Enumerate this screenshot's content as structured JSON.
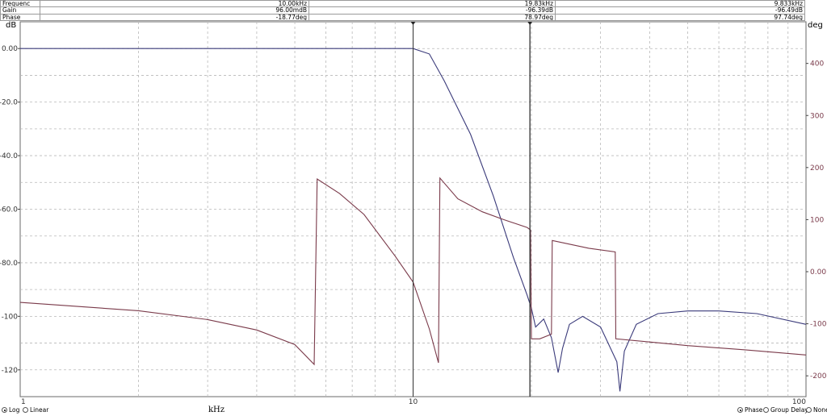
{
  "readout": {
    "rows": [
      {
        "label": "Frequenc",
        "c1": "10.00kHz",
        "c2": "19.83kHz",
        "c3": "9.833kHz"
      },
      {
        "label": "Gain",
        "c1": "96.00mdB",
        "c2": "-96.39dB",
        "c3": "-96.49dB"
      },
      {
        "label": "Phase",
        "c1": "-18.77deg",
        "c2": "78.97deg",
        "c3": "97.74deg"
      }
    ]
  },
  "axes": {
    "left_unit": "dB",
    "right_unit": "deg",
    "xlabel": "kHz"
  },
  "controls": {
    "scale_options": [
      {
        "label": "Log",
        "selected": true
      },
      {
        "label": "Linear",
        "selected": false
      }
    ],
    "view_options": [
      {
        "label": "Phase",
        "selected": true
      },
      {
        "label": "Group Delay",
        "selected": false
      },
      {
        "label": "None",
        "selected": false
      }
    ]
  },
  "chart_data": {
    "type": "line",
    "x_scale": "log",
    "xlim": [
      1,
      100
    ],
    "x_ticks": [
      "1",
      "10",
      "100"
    ],
    "ylim_left": [
      -130,
      10
    ],
    "y_left_ticks": [
      "0.00",
      "-20.0",
      "-40.0",
      "-60.0",
      "-80.0",
      "-100",
      "-120"
    ],
    "ylim_right": [
      -240,
      480
    ],
    "y_right_ticks": [
      "400",
      "300",
      "200",
      "100",
      "0.00",
      "-100",
      "-200"
    ],
    "grid": true,
    "cursors_khz": [
      10.0,
      19.83
    ],
    "series": [
      {
        "axis": "left",
        "color": "#3a3a7a",
        "x": [
          1,
          8.0,
          9.0,
          10.0,
          11.0,
          12.0,
          14.0,
          16.0,
          18.0,
          19.5,
          20.0,
          20.5,
          21.5,
          22.5,
          23.4,
          24.0,
          25.0,
          27.0,
          30.0,
          33.0,
          33.6,
          34.5,
          37.0,
          42.0,
          50.0,
          60.0,
          75.0,
          100.0
        ],
        "y": [
          0,
          0,
          0,
          0,
          -2,
          -12,
          -32,
          -55,
          -78,
          -92,
          -97,
          -104,
          -101,
          -108,
          -121,
          -112,
          -103,
          -100,
          -104,
          -117,
          -128,
          -113,
          -103,
          -99,
          -98,
          -98,
          -99,
          -103
        ]
      },
      {
        "axis": "right",
        "color": "#7a3a4a",
        "x": [
          1,
          2,
          3,
          4,
          5,
          5.6,
          5.7,
          6.5,
          7.5,
          9.0,
          10.0,
          11.0,
          11.6,
          11.7,
          13.0,
          15.0,
          17.0,
          19.5,
          19.9,
          20.0,
          21.0,
          22.5,
          22.6,
          28.0,
          32.7,
          32.8,
          40.0,
          50.0,
          70.0,
          100.0
        ],
        "y": [
          -59,
          -75,
          -92,
          -112,
          -140,
          -178,
          178,
          150,
          110,
          30,
          -20,
          -110,
          -175,
          180,
          140,
          115,
          100,
          85,
          80,
          -129,
          -129,
          -120,
          60,
          45,
          38,
          -129,
          -135,
          -142,
          -150,
          -160
        ]
      }
    ]
  }
}
